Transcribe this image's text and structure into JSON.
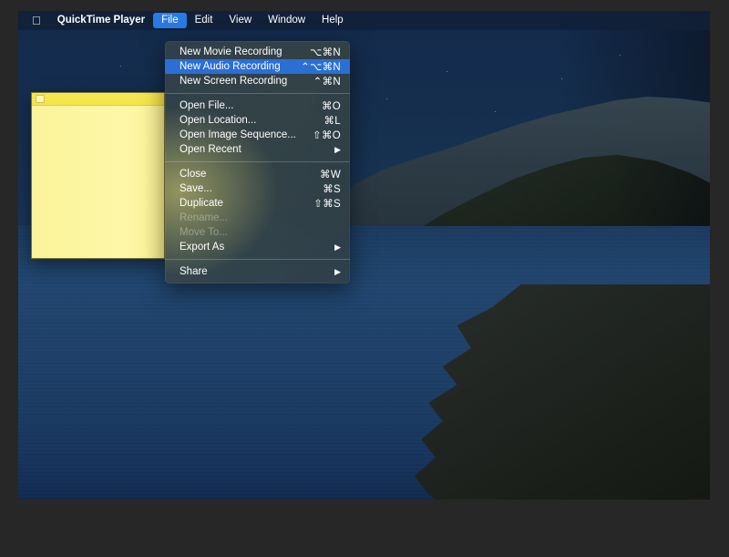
{
  "menubar": {
    "apple_icon": "apple-logo-icon",
    "items": [
      {
        "label": "QuickTime Player",
        "bold": true,
        "active": false
      },
      {
        "label": "File",
        "bold": false,
        "active": true
      },
      {
        "label": "Edit",
        "bold": false,
        "active": false
      },
      {
        "label": "View",
        "bold": false,
        "active": false
      },
      {
        "label": "Window",
        "bold": false,
        "active": false
      },
      {
        "label": "Help",
        "bold": false,
        "active": false
      }
    ],
    "highlight_color": "#2a7ae4"
  },
  "file_menu": {
    "highlight_color": "#2a6fd4",
    "groups": [
      {
        "items": [
          {
            "label": "New Movie Recording",
            "shortcut": "⌥⌘N",
            "arrow": "",
            "disabled": false,
            "highlighted": false
          },
          {
            "label": "New Audio Recording",
            "shortcut": "⌃⌥⌘N",
            "arrow": "",
            "disabled": false,
            "highlighted": true
          },
          {
            "label": "New Screen Recording",
            "shortcut": "⌃⌘N",
            "arrow": "",
            "disabled": false,
            "highlighted": false
          }
        ]
      },
      {
        "items": [
          {
            "label": "Open File...",
            "shortcut": "⌘O",
            "arrow": "",
            "disabled": false,
            "highlighted": false
          },
          {
            "label": "Open Location...",
            "shortcut": "⌘L",
            "arrow": "",
            "disabled": false,
            "highlighted": false
          },
          {
            "label": "Open Image Sequence...",
            "shortcut": "⇧⌘O",
            "arrow": "",
            "disabled": false,
            "highlighted": false
          },
          {
            "label": "Open Recent",
            "shortcut": "",
            "arrow": "▶",
            "disabled": false,
            "highlighted": false
          }
        ]
      },
      {
        "items": [
          {
            "label": "Close",
            "shortcut": "⌘W",
            "arrow": "",
            "disabled": false,
            "highlighted": false
          },
          {
            "label": "Save...",
            "shortcut": "⌘S",
            "arrow": "",
            "disabled": false,
            "highlighted": false
          },
          {
            "label": "Duplicate",
            "shortcut": "⇧⌘S",
            "arrow": "",
            "disabled": false,
            "highlighted": false
          },
          {
            "label": "Rename...",
            "shortcut": "",
            "arrow": "",
            "disabled": true,
            "highlighted": false
          },
          {
            "label": "Move To...",
            "shortcut": "",
            "arrow": "",
            "disabled": true,
            "highlighted": false
          },
          {
            "label": "Export As",
            "shortcut": "",
            "arrow": "▶",
            "disabled": false,
            "highlighted": false
          }
        ]
      },
      {
        "items": [
          {
            "label": "Share",
            "shortcut": "",
            "arrow": "▶",
            "disabled": false,
            "highlighted": false
          }
        ]
      }
    ]
  },
  "note_window": {
    "title": "",
    "body_text": "",
    "paper_color": "#fcf499",
    "titlebar_color": "#f5e64d"
  },
  "desktop": {
    "wallpaper_name": "catalina-night-wallpaper",
    "sky_color": "#16304f",
    "water_color": "#1e4069",
    "mountain_color": "#3b443d"
  }
}
